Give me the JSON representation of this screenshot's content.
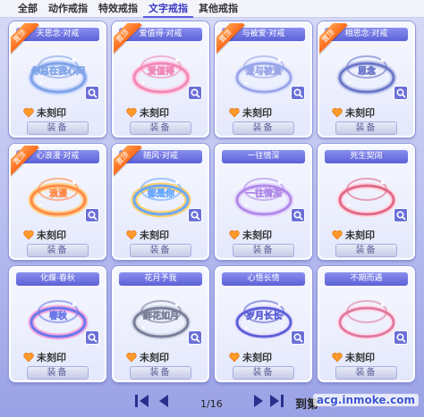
{
  "tabs": [
    {
      "label": "全部"
    },
    {
      "label": "动作戒指"
    },
    {
      "label": "特效戒指"
    },
    {
      "label": "文字戒指",
      "active": true
    },
    {
      "label": "其他戒指"
    }
  ],
  "ribbon_label": "置顶",
  "status_label": "未刻印",
  "equip_label": "装备",
  "accent_color": "#5b61d6",
  "items": [
    {
      "title": "天思念·对戒",
      "pinned": true,
      "ring_text": "你总在我心间",
      "icon": "ring-icon"
    },
    {
      "title": "爱值得·对戒",
      "pinned": true,
      "ring_text": "爱值得",
      "icon": "ring-icon"
    },
    {
      "title": "与被爱·对戒",
      "pinned": true,
      "ring_text": "爱与被爱",
      "icon": "ring-icon"
    },
    {
      "title": "相思念·对戒",
      "pinned": true,
      "ring_text": "思念",
      "icon": "ring-icon"
    },
    {
      "title": "心浪漫·对戒",
      "pinned": true,
      "ring_text": "浪漫",
      "icon": "ring-icon"
    },
    {
      "title": "随风·对戒",
      "pinned": true,
      "ring_text": "都是你",
      "icon": "ring-icon"
    },
    {
      "title": "一往情深",
      "pinned": false,
      "ring_text": "一往情深",
      "icon": "ring-icon"
    },
    {
      "title": "死生契阔",
      "pinned": false,
      "ring_text": "",
      "icon": "ring-icon"
    },
    {
      "title": "化蝶·春秋",
      "pinned": false,
      "ring_text": "春秋",
      "icon": "ring-icon"
    },
    {
      "title": "花月予我",
      "pinned": false,
      "ring_text": "鲜花如月",
      "icon": "ring-icon"
    },
    {
      "title": "心悟长情",
      "pinned": false,
      "ring_text": "岁月长长",
      "icon": "ring-icon"
    },
    {
      "title": "不期而遇",
      "pinned": false,
      "ring_text": "",
      "icon": "ring-icon"
    }
  ],
  "pagination": {
    "page": "1/16",
    "goto_label": "到第"
  },
  "watermark": "acg.inmoke.com"
}
